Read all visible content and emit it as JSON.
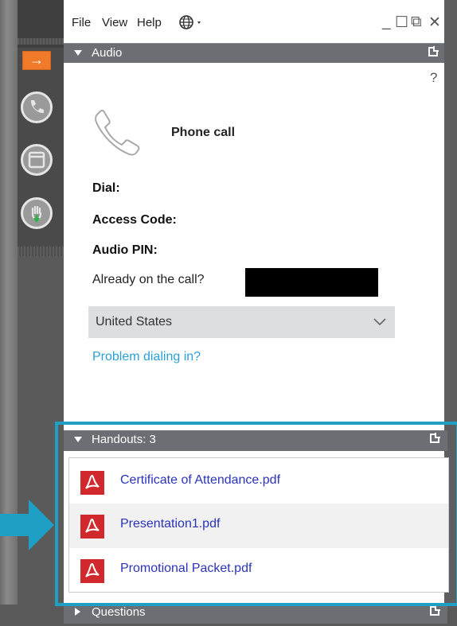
{
  "menu": {
    "file": "File",
    "view": "View",
    "help": "Help"
  },
  "window_controls": {
    "minimize": "_",
    "maximize": "☐",
    "restore": "⧉",
    "close": "✕"
  },
  "rail": {
    "arrow": "→"
  },
  "audio": {
    "header": "Audio",
    "help": "?",
    "phone_label": "Phone call",
    "dial_label": "Dial:",
    "access_code_label": "Access Code:",
    "audio_pin_label": "Audio PIN:",
    "already_label": "Already on the call?",
    "country": "United States",
    "problem_link": "Problem dialing in?"
  },
  "handouts": {
    "header": "Handouts: 3",
    "files": [
      "Certificate of Attendance.pdf",
      "Presentation1.pdf",
      "Promotional Packet.pdf"
    ]
  },
  "questions": {
    "header": "Questions"
  },
  "colors": {
    "accent_orange": "#ee7a2a",
    "highlight": "#1f9fc4",
    "link": "#2aa0d6",
    "file_link": "#2a33b8",
    "pdf_red": "#d0282c"
  },
  "icons": [
    "arrow-right-icon",
    "phone-icon",
    "window-icon",
    "raise-hand-icon",
    "globe-icon",
    "pdf-icon",
    "popout-icon"
  ]
}
